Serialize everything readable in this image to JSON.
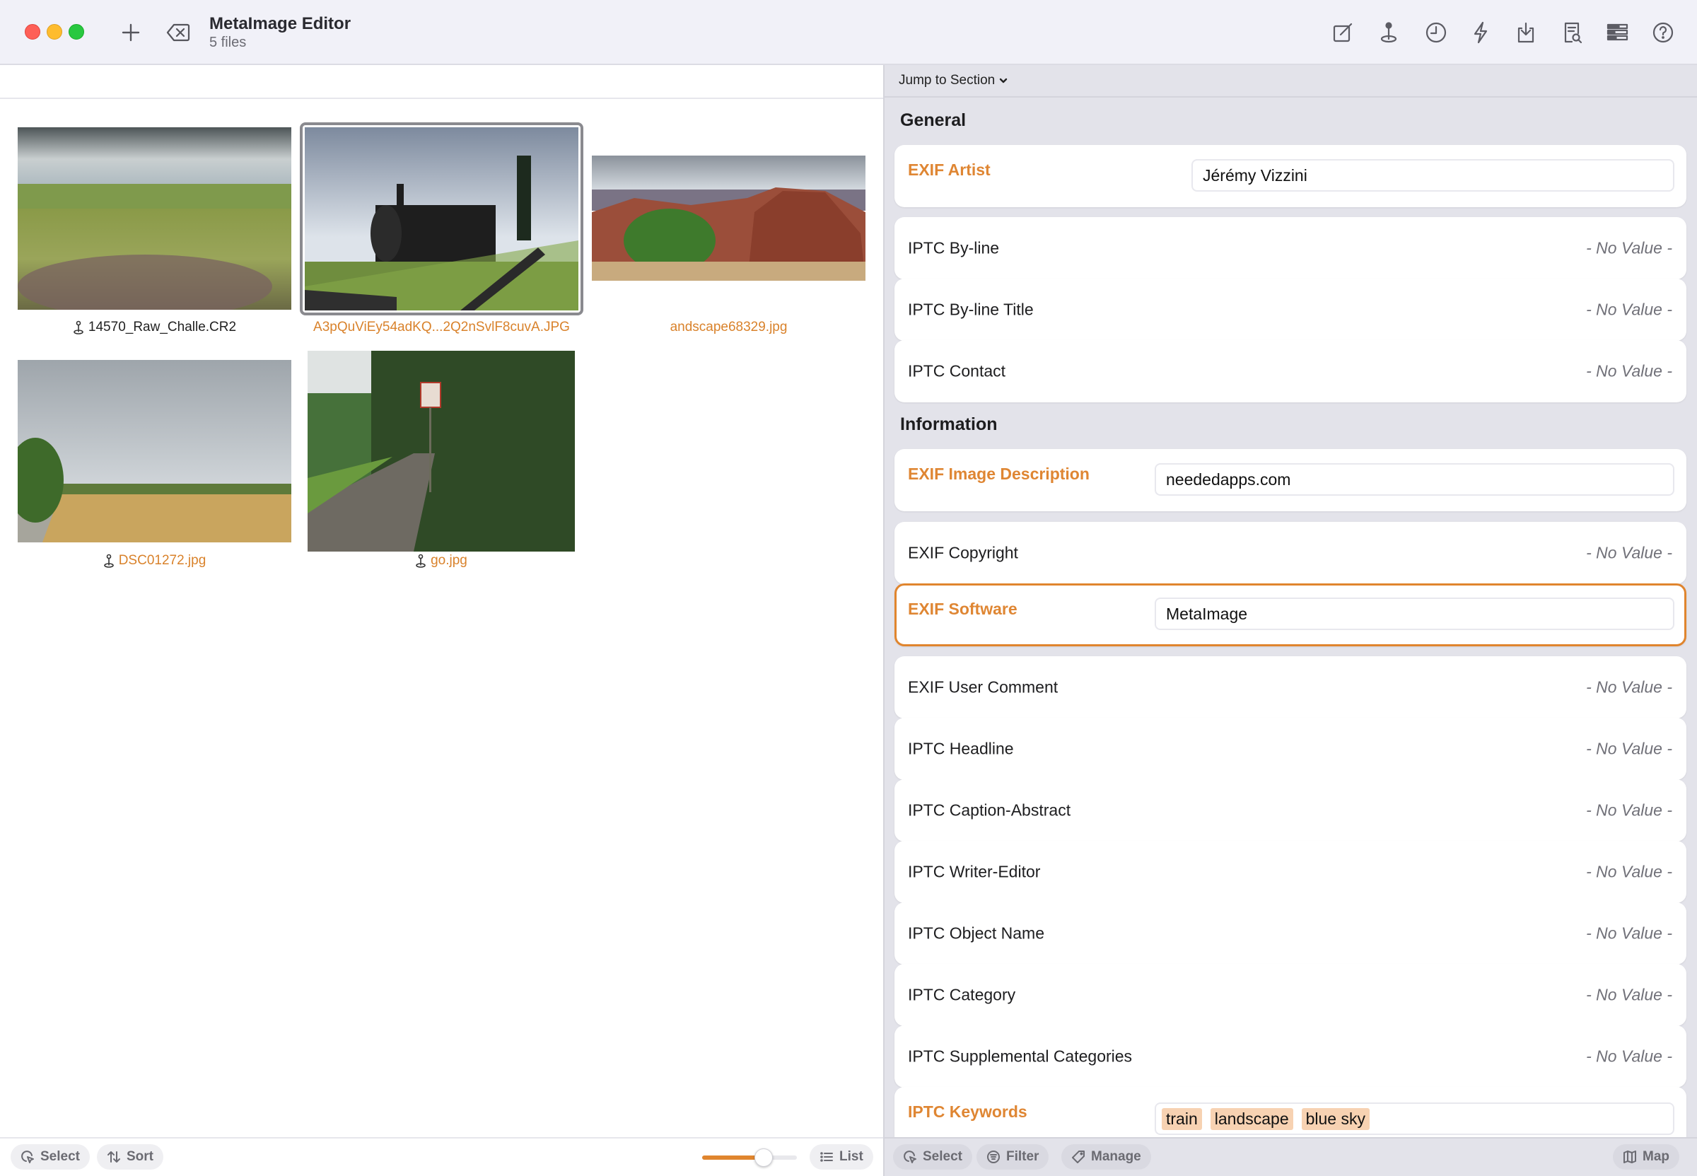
{
  "window": {
    "title": "MetaImage Editor",
    "subtitle": "5 files"
  },
  "titlebar": {
    "add_icon": "plus-icon",
    "remove_icon": "delete-left-icon",
    "tools": [
      {
        "name": "edit-icon"
      },
      {
        "name": "location-pin-icon"
      },
      {
        "name": "clock-icon"
      },
      {
        "name": "lightning-icon"
      },
      {
        "name": "import-icon"
      },
      {
        "name": "document-search-icon"
      },
      {
        "name": "fields-list-icon"
      },
      {
        "name": "help-icon"
      }
    ]
  },
  "files": [
    {
      "name": "14570_Raw_Challe.CR2",
      "geotagged": true,
      "modified": false,
      "selected": false
    },
    {
      "name": "A3pQuViEy54adKQ...2Q2nSvlF8cuvA.JPG",
      "geotagged": false,
      "modified": true,
      "selected": true
    },
    {
      "name": "andscape68329.jpg",
      "geotagged": false,
      "modified": true,
      "selected": false
    },
    {
      "name": "DSC01272.jpg",
      "geotagged": true,
      "modified": true,
      "selected": false
    },
    {
      "name": "go.jpg",
      "geotagged": true,
      "modified": true,
      "selected": false
    }
  ],
  "left_footer": {
    "select_label": "Select",
    "sort_label": "Sort",
    "thumbnail_size_percent": 65,
    "list_label": "List"
  },
  "inspector": {
    "jump_label": "Jump to Section",
    "sections": [
      {
        "title": "General",
        "fields": [
          {
            "label": "EXIF Artist",
            "value": "Jérémy Vizzini",
            "edited": true
          },
          {
            "label": "IPTC By-line",
            "value": "- No Value -",
            "edited": false
          },
          {
            "label": "IPTC By-line Title",
            "value": "- No Value -",
            "edited": false
          },
          {
            "label": "IPTC Contact",
            "value": "- No Value -",
            "edited": false
          }
        ]
      },
      {
        "title": "Information",
        "fields": [
          {
            "label": "EXIF Image Description",
            "value": "neededapps.com",
            "edited": true
          },
          {
            "label": "EXIF Copyright",
            "value": "- No Value -",
            "edited": false
          },
          {
            "label": "EXIF Software",
            "value": "MetaImage",
            "edited": true,
            "focused": true
          },
          {
            "label": "EXIF User Comment",
            "value": "- No Value -",
            "edited": false
          },
          {
            "label": "IPTC Headline",
            "value": "- No Value -",
            "edited": false
          },
          {
            "label": "IPTC Caption-Abstract",
            "value": "- No Value -",
            "edited": false
          },
          {
            "label": "IPTC Writer-Editor",
            "value": "- No Value -",
            "edited": false
          },
          {
            "label": "IPTC Object Name",
            "value": "- No Value -",
            "edited": false
          },
          {
            "label": "IPTC Category",
            "value": "- No Value -",
            "edited": false
          },
          {
            "label": "IPTC Supplemental Categories",
            "value": "- No Value -",
            "edited": false
          },
          {
            "label": "IPTC Keywords",
            "tags": [
              "train",
              "landscape",
              "blue sky"
            ],
            "edited": true
          }
        ]
      }
    ]
  },
  "right_footer": {
    "select_label": "Select",
    "filter_label": "Filter",
    "manage_label": "Manage",
    "map_label": "Map"
  },
  "colors": {
    "accent": "#e0852e",
    "edited_label": "#df8633",
    "tag_bg": "#f7d2b2"
  }
}
